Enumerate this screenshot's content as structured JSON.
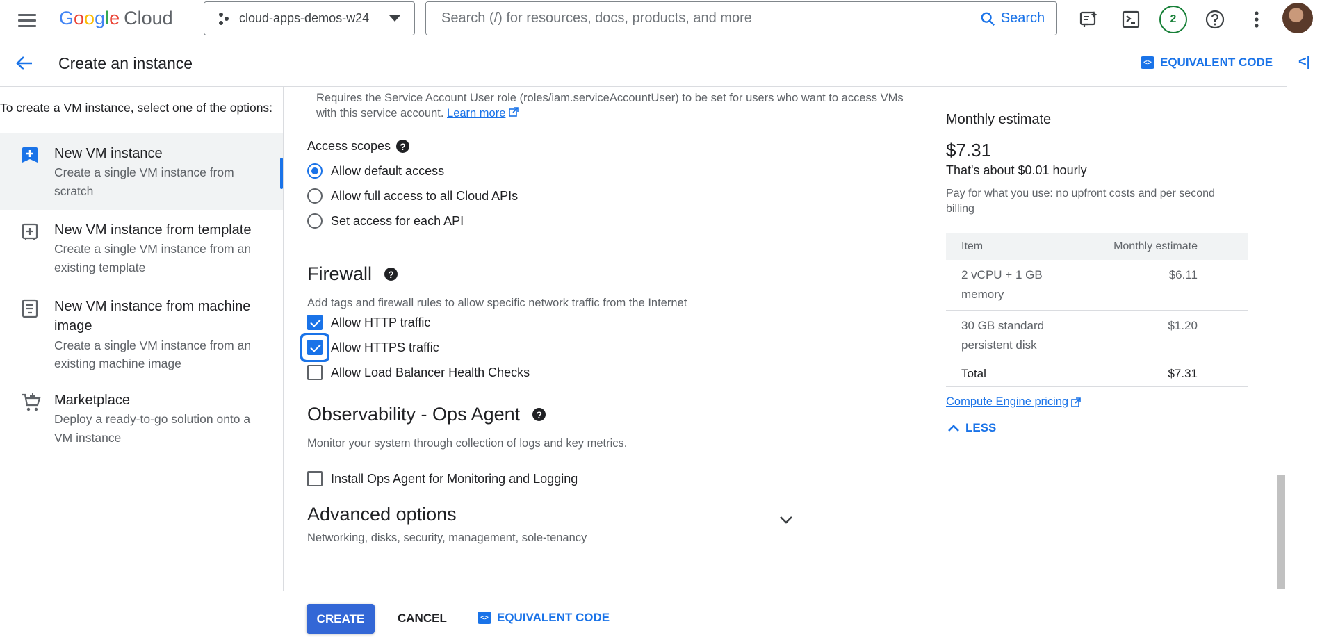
{
  "topbar": {
    "logo_google": [
      "G",
      "o",
      "o",
      "g",
      "l",
      "e"
    ],
    "logo_cloud": "Cloud",
    "project_name": "cloud-apps-demos-w24",
    "search_placeholder": "Search (/) for resources, docs, products, and more",
    "search_button": "Search",
    "notifications_count": "2"
  },
  "header": {
    "title": "Create an instance",
    "equivalent_code": "EQUIVALENT CODE"
  },
  "sidebar": {
    "intro": "To create a VM instance, select one of the options:",
    "items": [
      {
        "title": "New VM instance",
        "desc1": "Create a single VM instance from",
        "desc2": "scratch",
        "icon": "add-box-icon",
        "active": true
      },
      {
        "title": "New VM instance from template",
        "desc1": "Create a single VM instance from an",
        "desc2": "existing template",
        "icon": "add-template-icon",
        "active": false
      },
      {
        "title": "New VM instance from machine",
        "title2": "image",
        "desc1": "Create a single VM instance from an",
        "desc2": "existing machine image",
        "icon": "machine-image-icon",
        "active": false
      },
      {
        "title": "Marketplace",
        "desc1": "Deploy a ready-to-go solution onto a",
        "desc2": "VM instance",
        "icon": "cart-icon",
        "active": false
      }
    ]
  },
  "main": {
    "service_account_note": "Requires the Service Account User role (roles/iam.serviceAccountUser) to be set for users who want to access VMs with this service account.",
    "learn_more": "Learn more",
    "access_scopes": {
      "label": "Access scopes",
      "options": [
        "Allow default access",
        "Allow full access to all Cloud APIs",
        "Set access for each API"
      ],
      "selected": "Allow default access"
    },
    "firewall": {
      "title": "Firewall",
      "desc": "Add tags and firewall rules to allow specific network traffic from the Internet",
      "options": [
        {
          "label": "Allow HTTP traffic",
          "checked": true
        },
        {
          "label": "Allow HTTPS traffic",
          "checked": true
        },
        {
          "label": "Allow Load Balancer Health Checks",
          "checked": false
        }
      ]
    },
    "observability": {
      "title": "Observability - Ops Agent",
      "desc": "Monitor your system through collection of logs and key metrics.",
      "option": "Install Ops Agent for Monitoring and Logging",
      "checked": false
    },
    "advanced": {
      "title": "Advanced options",
      "desc": "Networking, disks, security, management, sole-tenancy"
    }
  },
  "estimate": {
    "title": "Monthly estimate",
    "price": "$7.31",
    "hourly": "That's about $0.01 hourly",
    "pay_note": "Pay for what you use: no upfront costs and per second billing",
    "col_item": "Item",
    "col_estimate": "Monthly estimate",
    "rows": [
      {
        "item1": "2 vCPU + 1 GB",
        "item2": "memory",
        "value": "$6.11"
      },
      {
        "item1": "30 GB standard",
        "item2": "persistent disk",
        "value": "$1.20"
      }
    ],
    "total_label": "Total",
    "total_value": "$7.31",
    "pricing_link": "Compute Engine pricing",
    "less": "LESS"
  },
  "footer": {
    "create": "CREATE",
    "cancel": "CANCEL",
    "equivalent_code": "EQUIVALENT CODE"
  },
  "colors": {
    "accent": "#1a73e8",
    "create_button": "#3367d6",
    "badge": "#188038"
  }
}
